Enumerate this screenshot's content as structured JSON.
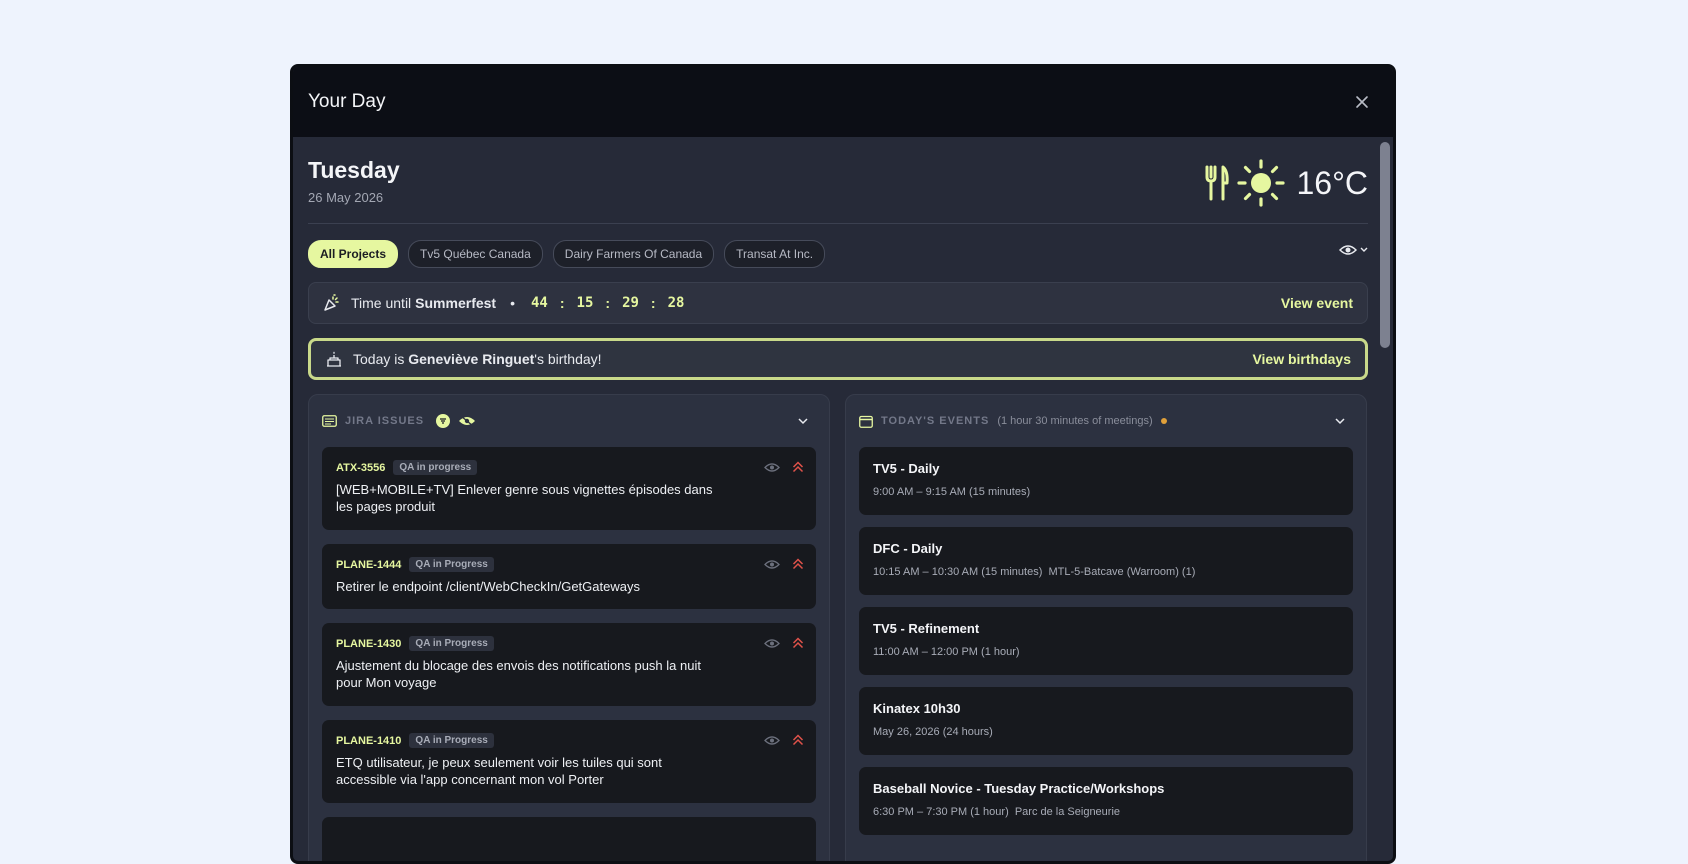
{
  "window": {
    "title": "Your Day"
  },
  "day": {
    "name": "Tuesday",
    "date": "26 May 2026"
  },
  "weather": {
    "temperature": "16°C",
    "condition": "sunny",
    "icons": [
      "utensils-icon",
      "sun-icon"
    ]
  },
  "filters": [
    "All Projects",
    "Tv5 Québec Canada",
    "Dairy Farmers Of Canada",
    "Transat At Inc."
  ],
  "active_filter": "All Projects",
  "countdown": {
    "prefix": "Time until",
    "event": "Summerfest",
    "separator": "•",
    "days": "44",
    "hours": "15",
    "minutes": "29",
    "seconds": "28",
    "link": "View event"
  },
  "birthday": {
    "prefix": "Today is",
    "name": "Geneviève Ringuet",
    "suffix": "'s birthday!",
    "link": "View birthdays"
  },
  "jira": {
    "title": "JIRA ISSUES",
    "issues": [
      {
        "key": "ATX-3556",
        "status": "QA in progress",
        "title": "[WEB+MOBILE+TV] Enlever genre sous vignettes épisodes dans les pages produit"
      },
      {
        "key": "PLANE-1444",
        "status": "QA in Progress",
        "title": "Retirer le endpoint /client/WebCheckIn/GetGateways"
      },
      {
        "key": "PLANE-1430",
        "status": "QA in Progress",
        "title": "Ajustement du blocage des envois des notifications push la nuit pour Mon voyage"
      },
      {
        "key": "PLANE-1410",
        "status": "QA in Progress",
        "title": "ETQ utilisateur, je peux seulement voir les tuiles qui sont accessible via l'app concernant mon vol Porter"
      }
    ]
  },
  "events": {
    "title": "TODAY'S EVENTS",
    "summary": "(1 hour 30 minutes of meetings)",
    "items": [
      {
        "title": "TV5 - Daily",
        "time": "9:00 AM – 9:15 AM (15 minutes)"
      },
      {
        "title": "DFC - Daily",
        "time": "10:15 AM – 10:30 AM (15 minutes)  MTL-5-Batcave (Warroom) (1)"
      },
      {
        "title": "TV5 - Refinement",
        "time": "11:00 AM – 12:00 PM (1 hour)"
      },
      {
        "title": "Kinatex 10h30",
        "time": "May 26, 2026 (24 hours)"
      },
      {
        "title": "Baseball Novice - Tuesday Practice/Workshops",
        "time": "6:30 PM – 7:30 PM (1 hour)  Parc de la Seigneurie"
      }
    ]
  },
  "colors": {
    "accent": "#e6f7a0",
    "priority": "#e0524a",
    "background": "#eef3fd"
  }
}
